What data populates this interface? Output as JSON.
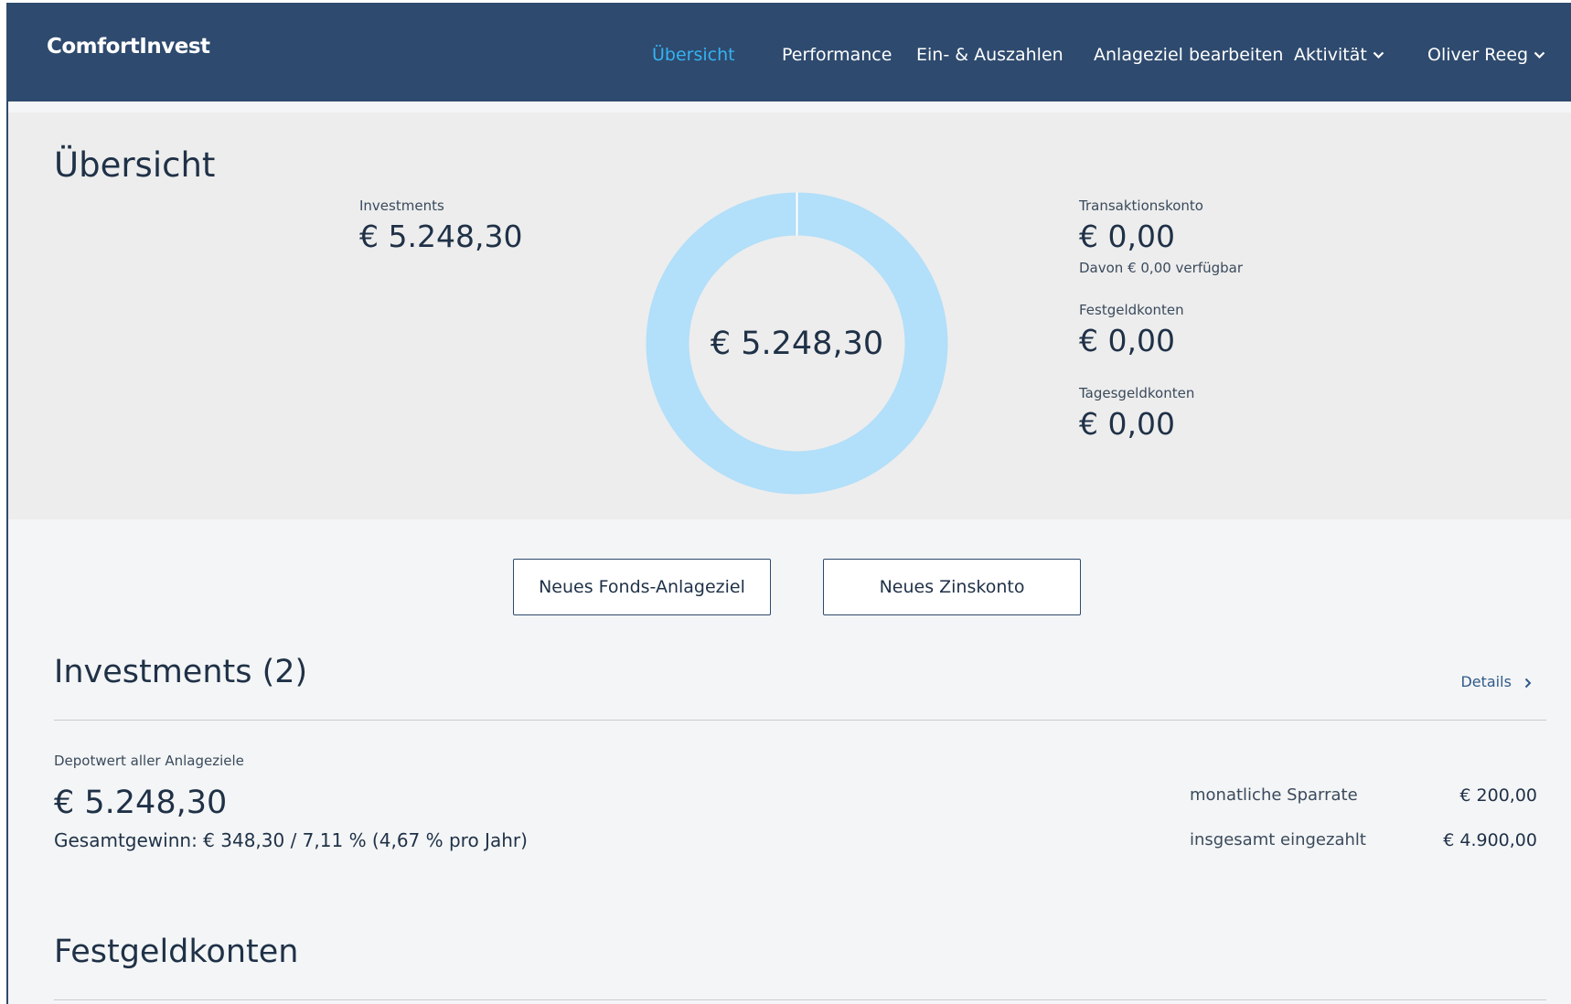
{
  "header": {
    "brand": "ComfortInvest",
    "nav": [
      {
        "label": "Übersicht",
        "active": true
      },
      {
        "label": "Performance"
      },
      {
        "label": "Ein- & Auszahlen"
      },
      {
        "label": "Anlageziel bearbeiten"
      },
      {
        "label": "Aktivität"
      },
      {
        "label": "Oliver Reeg"
      }
    ]
  },
  "overview": {
    "title": "Übersicht",
    "investments_label": "Investments",
    "investments_value": "€ 5.248,30",
    "donut_center": "€ 5.248,30",
    "transaktionskonto_label": "Transaktionskonto",
    "transaktionskonto_value": "€ 0,00",
    "transaktionskonto_note": "Davon € 0,00 verfügbar",
    "festgeld_label": "Festgeldkonten",
    "festgeld_value": "€ 0,00",
    "tagesgeld_label": "Tagesgeldkonten",
    "tagesgeld_value": "€ 0,00"
  },
  "chart_data": {
    "type": "pie",
    "categories": [
      "Investments",
      "Transaktionskonto",
      "Festgeldkonten",
      "Tagesgeldkonten"
    ],
    "values": [
      5248.3,
      0,
      0,
      0
    ],
    "colors": [
      "#b2dff9",
      "#2e4a6e",
      "#6b8fb5",
      "#35b2f2"
    ]
  },
  "actions": {
    "new_fonds_label": "Neues Fonds-Anlageziel",
    "new_zinskonto_label": "Neues Zinskonto"
  },
  "investments_section": {
    "title": "Investments (2)",
    "details_label": "Details",
    "depot_label": "Depotwert aller Anlageziele",
    "depot_value": "€ 5.248,30",
    "gain_text": "Gesamtgewinn: € 348,30 / 7,11 % (4,67 % pro Jahr)",
    "rows": [
      {
        "label": "monatliche Sparrate",
        "value": "€ 200,00"
      },
      {
        "label": "insgesamt eingezahlt",
        "value": "€ 4.900,00"
      }
    ]
  },
  "festgeld_section": {
    "title": "Festgeldkonten"
  },
  "colors": {
    "header_bg": "#2e4a6e",
    "accent": "#35b2f2",
    "donut": "#b2dff9"
  }
}
